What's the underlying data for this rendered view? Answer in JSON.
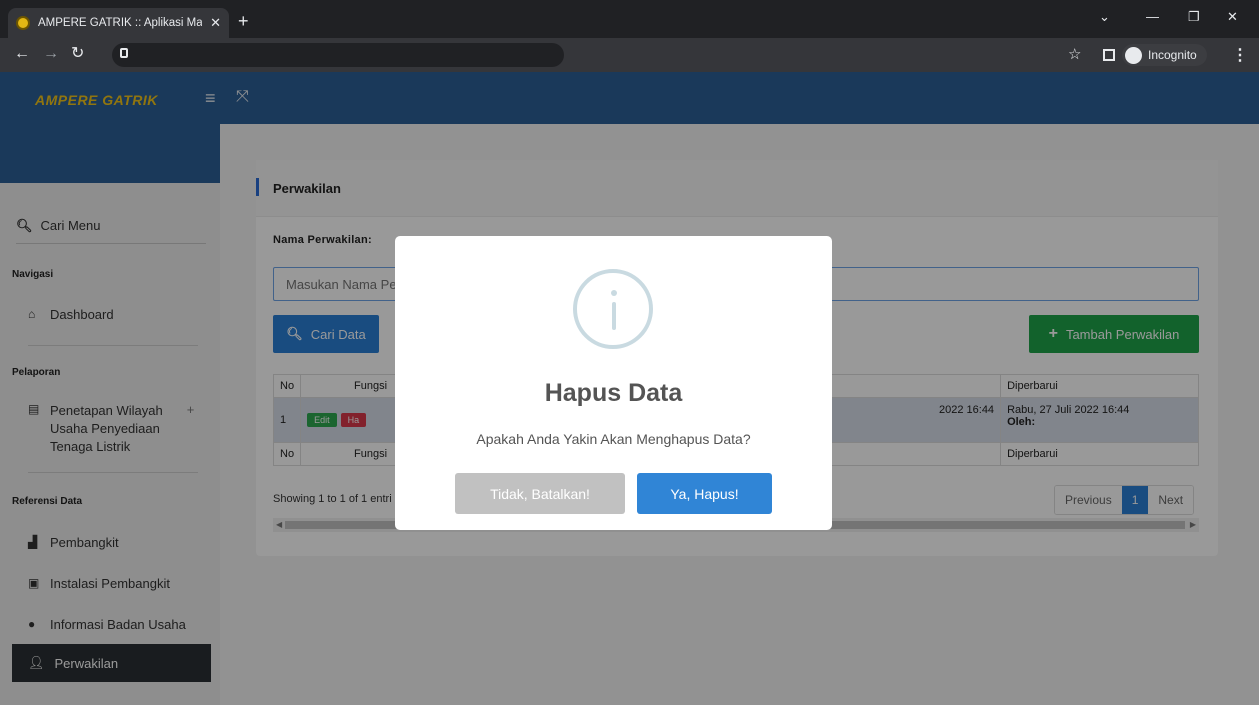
{
  "browser": {
    "tab_title": "AMPERE GATRIK :: Aplikasi Mana",
    "incognito_label": "Incognito"
  },
  "app": {
    "brand": "AMPERE GATRIK"
  },
  "sidebar": {
    "search_label": "Cari Menu",
    "sections": {
      "navigasi": "Navigasi",
      "pelaporan": "Pelaporan",
      "referensi": "Referensi Data"
    },
    "items": {
      "dashboard": "Dashboard",
      "penetapan_line1": "Penetapan Wilayah",
      "penetapan_line2": "Usaha Penyediaan",
      "penetapan_line3": "Tenaga Listrik",
      "pembangkit": "Pembangkit",
      "instalasi": "Instalasi Pembangkit",
      "informasi": "Informasi Badan Usaha",
      "perwakilan": "Perwakilan"
    }
  },
  "page": {
    "card_title": "Perwakilan",
    "nama_label": "Nama Perwakilan:",
    "nama_placeholder": "Masukan Nama Pe",
    "cari_button": "Cari Data",
    "tambah_button": "Tambah Perwakilan"
  },
  "table": {
    "header": {
      "no": "No",
      "fungsi": "Fungsi",
      "diperbarui": "Diperbarui"
    },
    "row": {
      "no": "1",
      "edit": "Edit",
      "hapus": "Ha",
      "dibuat": "2022 16:44",
      "diperbarui": "Rabu, 27 Juli 2022 16:44",
      "oleh": "Oleh:"
    },
    "footer": {
      "no": "No",
      "fungsi": "Fungsi",
      "diperbarui": "Diperbarui"
    },
    "showing": "Showing 1 to 1 of 1 entri",
    "pagination": {
      "previous": "Previous",
      "page": "1",
      "next": "Next"
    }
  },
  "modal": {
    "title": "Hapus Data",
    "text": "Apakah Anda Yakin Akan Menghapus Data?",
    "cancel": "Tidak, Batalkan!",
    "confirm": "Ya, Hapus!"
  }
}
